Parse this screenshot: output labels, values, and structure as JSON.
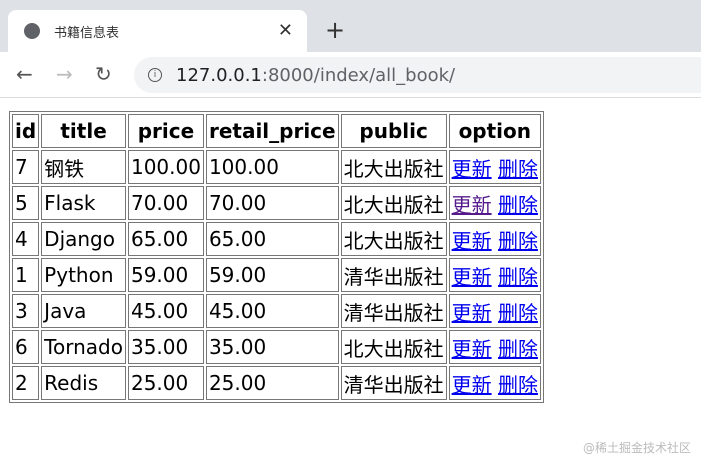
{
  "browser": {
    "tab_title": "书籍信息表",
    "url_host": "127.0.0.1",
    "url_path": ":8000/index/all_book/"
  },
  "table": {
    "headers": [
      "id",
      "title",
      "price",
      "retail_price",
      "public",
      "option"
    ],
    "rows": [
      {
        "id": "7",
        "title": "钢铁",
        "price": "100.00",
        "retail_price": "100.00",
        "public": "北大出版社"
      },
      {
        "id": "5",
        "title": "Flask",
        "price": "70.00",
        "retail_price": "70.00",
        "public": "北大出版社"
      },
      {
        "id": "4",
        "title": "Django",
        "price": "65.00",
        "retail_price": "65.00",
        "public": "北大出版社"
      },
      {
        "id": "1",
        "title": "Python",
        "price": "59.00",
        "retail_price": "59.00",
        "public": "清华出版社"
      },
      {
        "id": "3",
        "title": "Java",
        "price": "45.00",
        "retail_price": "45.00",
        "public": "清华出版社"
      },
      {
        "id": "6",
        "title": "Tornado",
        "price": "35.00",
        "retail_price": "35.00",
        "public": "北大出版社"
      },
      {
        "id": "2",
        "title": "Redis",
        "price": "25.00",
        "retail_price": "25.00",
        "public": "清华出版社"
      }
    ],
    "update_label": "更新",
    "delete_label": "删除"
  },
  "watermark": "@稀土掘金技术社区"
}
